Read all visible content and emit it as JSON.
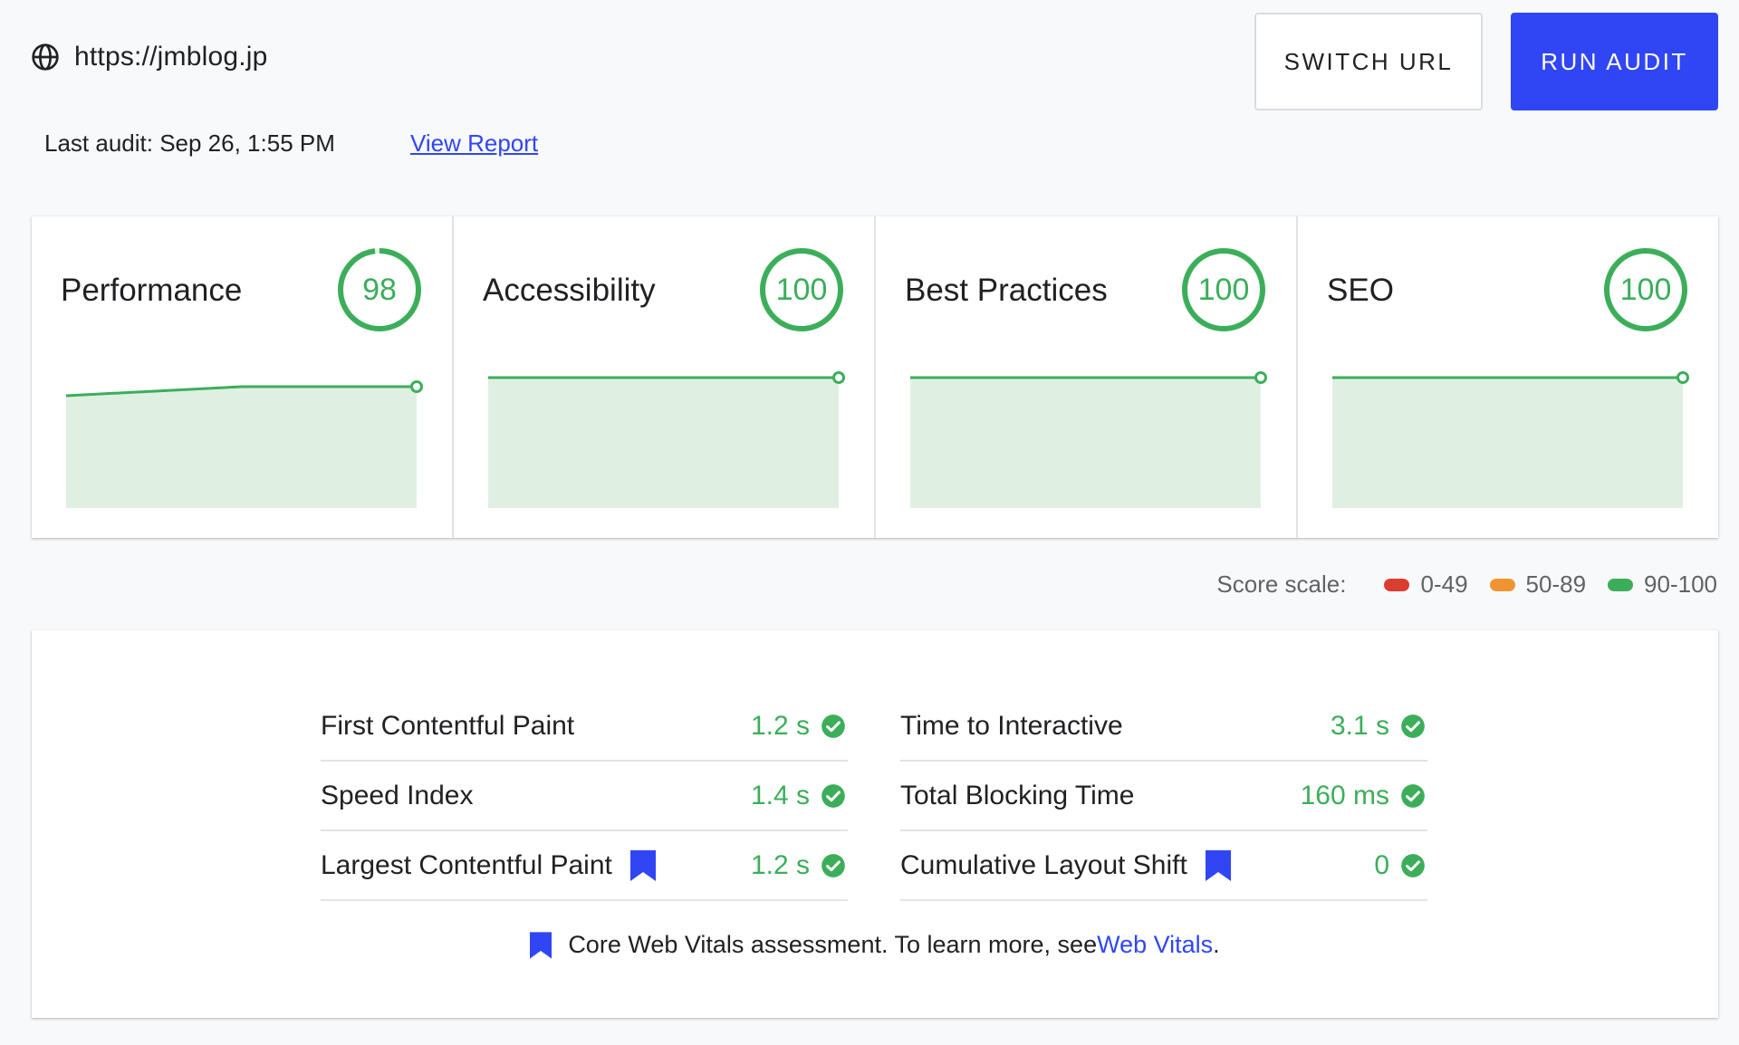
{
  "header": {
    "icon": "globe-icon",
    "url": "https://jmblog.jp",
    "switch_url_label": "SWITCH URL",
    "run_audit_label": "RUN AUDIT",
    "last_audit": "Last audit: Sep 26, 1:55 PM",
    "view_report_label": "View Report"
  },
  "categories": [
    {
      "title": "Performance",
      "score": "98",
      "score_value": 98,
      "history": [
        96,
        98,
        98
      ]
    },
    {
      "title": "Accessibility",
      "score": "100",
      "score_value": 100,
      "history": [
        100,
        100,
        100
      ]
    },
    {
      "title": "Best Practices",
      "score": "100",
      "score_value": 100,
      "history": [
        100,
        100,
        100
      ]
    },
    {
      "title": "SEO",
      "score": "100",
      "score_value": 100,
      "history": [
        100,
        100,
        100
      ]
    }
  ],
  "score_scale": {
    "label": "Score scale:",
    "items": [
      {
        "range": "0-49",
        "color": "#db3d31"
      },
      {
        "range": "50-89",
        "color": "#f09433"
      },
      {
        "range": "90-100",
        "color": "#3cae5a"
      }
    ]
  },
  "metrics": {
    "left": [
      {
        "name": "First Contentful Paint",
        "value": "1.2 s",
        "core_web_vital": false
      },
      {
        "name": "Speed Index",
        "value": "1.4 s",
        "core_web_vital": false
      },
      {
        "name": "Largest Contentful Paint",
        "value": "1.2 s",
        "core_web_vital": true
      }
    ],
    "right": [
      {
        "name": "Time to Interactive",
        "value": "3.1 s",
        "core_web_vital": false
      },
      {
        "name": "Total Blocking Time",
        "value": "160 ms",
        "core_web_vital": false
      },
      {
        "name": "Cumulative Layout Shift",
        "value": "0",
        "core_web_vital": true
      }
    ],
    "footnote_text": "Core Web Vitals assessment. To learn more, see ",
    "footnote_link": "Web Vitals",
    "footnote_end": "."
  },
  "colors": {
    "good": "#3cae5a",
    "good_fill": "#dff0e2",
    "accent": "#3046f5"
  }
}
